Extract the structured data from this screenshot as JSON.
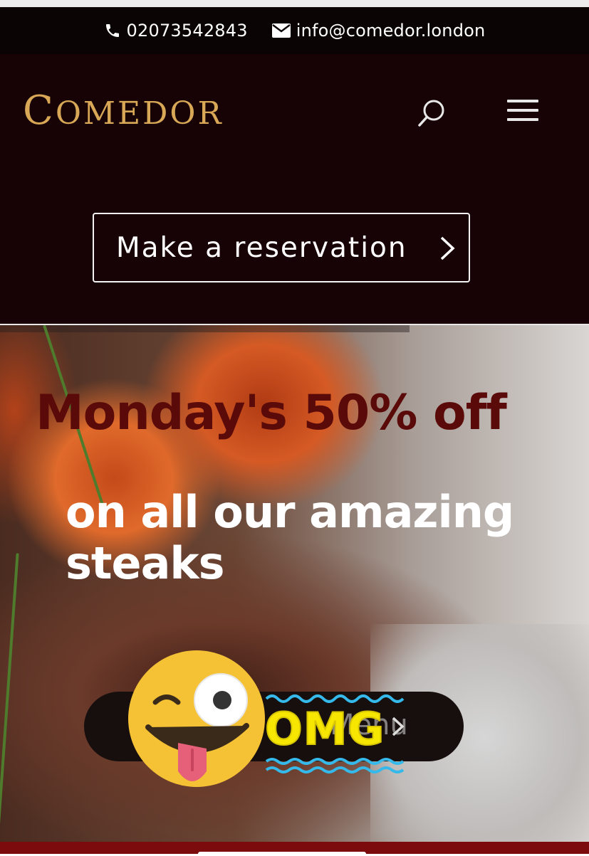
{
  "topbar": {
    "phone": "02073542843",
    "phone_icon": "phone-icon",
    "email": "info@comedor.london",
    "email_icon": "mail-icon"
  },
  "header": {
    "logo_first": "C",
    "logo_rest": "OMEDOR",
    "search_icon": "search-icon",
    "menu_icon": "hamburger-icon"
  },
  "reservation": {
    "label": "Make a reservation",
    "icon": "chevron-right-icon"
  },
  "hero": {
    "headline": "Monday's 50% off",
    "subline": "on all our amazing steaks",
    "button_label": "Menu",
    "button_icon": "chevron-right-icon",
    "sticker_text": "OMG",
    "sticker_emoji": "winking-face-with-tongue"
  },
  "colors": {
    "topbar_bg": "#0b0405",
    "header_bg": "#170305",
    "logo": "#d9a857",
    "headline": "#5a0a08",
    "footer": "#7b0b0d",
    "sticker": "#f6e600"
  }
}
